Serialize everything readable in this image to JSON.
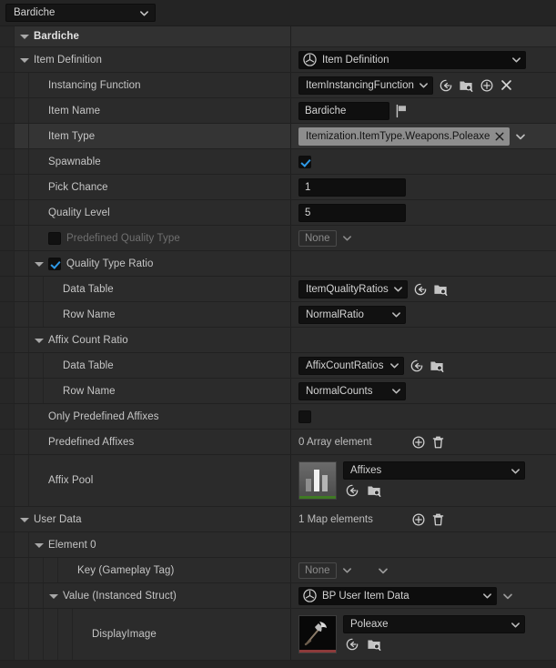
{
  "topbar": {
    "selected": "Bardiche"
  },
  "colors": {
    "row_bg": "#2b2b2b",
    "category_bg": "#313131",
    "selected_row_bg": "#343434",
    "checkbox_accent": "#2f9ae8",
    "tag_chip_bg": "#8d8d8d",
    "datatable_strip": "#3f7a23",
    "texture_strip": "#8d3a3a"
  },
  "rows": [
    {
      "key": "bardiche",
      "label": "Bardiche"
    },
    {
      "key": "item_definition",
      "label": "Item Definition",
      "value": "Item Definition"
    },
    {
      "key": "instancing_function",
      "label": "Instancing Function",
      "value": "ItemInstancingFunction"
    },
    {
      "key": "item_name",
      "label": "Item Name",
      "value": "Bardiche"
    },
    {
      "key": "item_type",
      "label": "Item Type",
      "value": "Itemization.ItemType.Weapons.Poleaxe"
    },
    {
      "key": "spawnable",
      "label": "Spawnable",
      "value": "checked"
    },
    {
      "key": "pick_chance",
      "label": "Pick Chance",
      "value": "1"
    },
    {
      "key": "quality_level",
      "label": "Quality Level",
      "value": "5"
    },
    {
      "key": "predefined_quality_type",
      "label": "Predefined Quality Type",
      "value": "None"
    },
    {
      "key": "quality_type_ratio",
      "label": "Quality Type Ratio"
    },
    {
      "key": "qtr_data_table",
      "label": "Data Table",
      "value": "ItemQualityRatios"
    },
    {
      "key": "qtr_row_name",
      "label": "Row Name",
      "value": "NormalRatio"
    },
    {
      "key": "affix_count_ratio",
      "label": "Affix Count Ratio"
    },
    {
      "key": "acr_data_table",
      "label": "Data Table",
      "value": "AffixCountRatios"
    },
    {
      "key": "acr_row_name",
      "label": "Row Name",
      "value": "NormalCounts"
    },
    {
      "key": "only_predefined_affixes",
      "label": "Only Predefined Affixes"
    },
    {
      "key": "predefined_affixes",
      "label": "Predefined Affixes",
      "value": "0 Array element"
    },
    {
      "key": "affix_pool",
      "label": "Affix Pool",
      "value": "Affixes"
    },
    {
      "key": "user_data",
      "label": "User Data",
      "value": "1 Map elements"
    },
    {
      "key": "element_0",
      "label": "Element 0"
    },
    {
      "key": "key_gameplay_tag",
      "label": "Key (Gameplay Tag)",
      "value": "None"
    },
    {
      "key": "value_instanced_struct",
      "label": "Value (Instanced Struct)",
      "value": "BP User Item Data"
    },
    {
      "key": "display_image",
      "label": "DisplayImage",
      "value": "Poleaxe"
    }
  ],
  "icons": {
    "dropdown": "chevron-down-icon",
    "browse_back": "use-selected-asset-icon",
    "browse": "browse-to-asset-icon",
    "add": "add-element-icon",
    "clear": "clear-icon",
    "delete": "delete-all-icon",
    "flag": "flag-icon",
    "blueprint": "blueprint-class-icon"
  }
}
